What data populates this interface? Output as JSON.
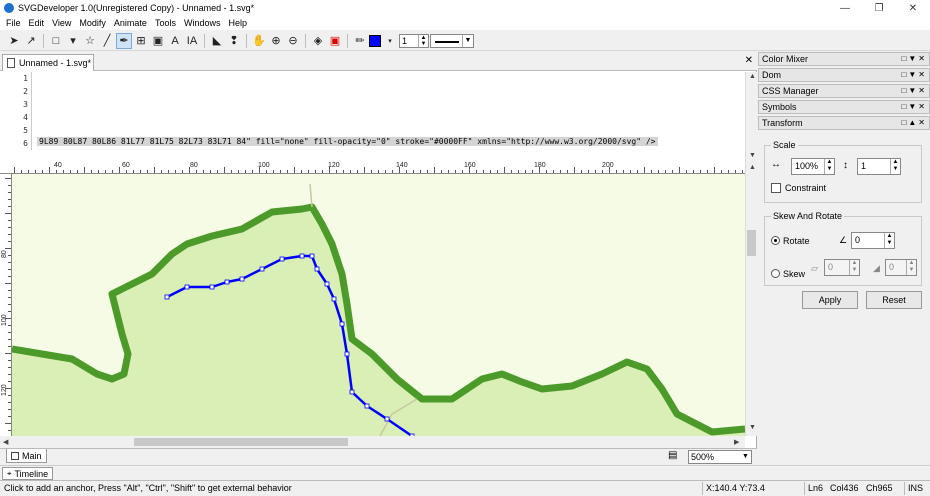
{
  "window": {
    "title": "SVGDeveloper 1.0(Unregistered Copy) - Unnamed - 1.svg*"
  },
  "menu": [
    "File",
    "Edit",
    "View",
    "Modify",
    "Animate",
    "Tools",
    "Windows",
    "Help"
  ],
  "toolbar": {
    "stroke_width": "1",
    "stroke_color": "#0000FF"
  },
  "doc_tab": {
    "label": "Unnamed - 1.svg*"
  },
  "code": {
    "line_numbers": [
      "1",
      "2",
      "3",
      "4",
      "5",
      "6"
    ],
    "line6": "9L89 80L87 80L86 81L77 81L75 82L73 83L71 84\" fill=\"none\" fill-opacity=\"0\" stroke=\"#0000FF\" xmlns=\"http://www.w3.org/2000/svg\" />"
  },
  "ruler": {
    "h_labels": [
      "40",
      "60",
      "80",
      "100",
      "120",
      "140",
      "160",
      "180",
      "200"
    ],
    "v_labels": [
      "80",
      "100",
      "120"
    ]
  },
  "canvas": {
    "path_color": "#0000FF",
    "terrain_dark": "#4c9a2a",
    "terrain_light": "#d6ecb0"
  },
  "bottom": {
    "main_tab": "Main",
    "zoom": "500%"
  },
  "panels": {
    "headers": [
      "Color Mixer",
      "Dom",
      "CSS Manager",
      "Symbols",
      "Transform"
    ],
    "transform": {
      "scale_title": "Scale",
      "scale_x": "100%",
      "scale_y": "1",
      "constraint_label": "Constraint",
      "skew_rotate_title": "Skew And Rotate",
      "rotate_label": "Rotate",
      "rotate_value": "0",
      "skew_label": "Skew",
      "skew_x": "0",
      "skew_y": "0",
      "apply_label": "Apply",
      "reset_label": "Reset"
    }
  },
  "timeline": {
    "label": "Timeline"
  },
  "status": {
    "message": "Click to add an anchor, Press \"Alt\", \"Ctrl\", \"Shift\" to get external behavior",
    "coords": "X:140.4  Y:73.4",
    "ln": "Ln6",
    "col": "Col436",
    "ch": "Ch965",
    "mode": "INS"
  }
}
